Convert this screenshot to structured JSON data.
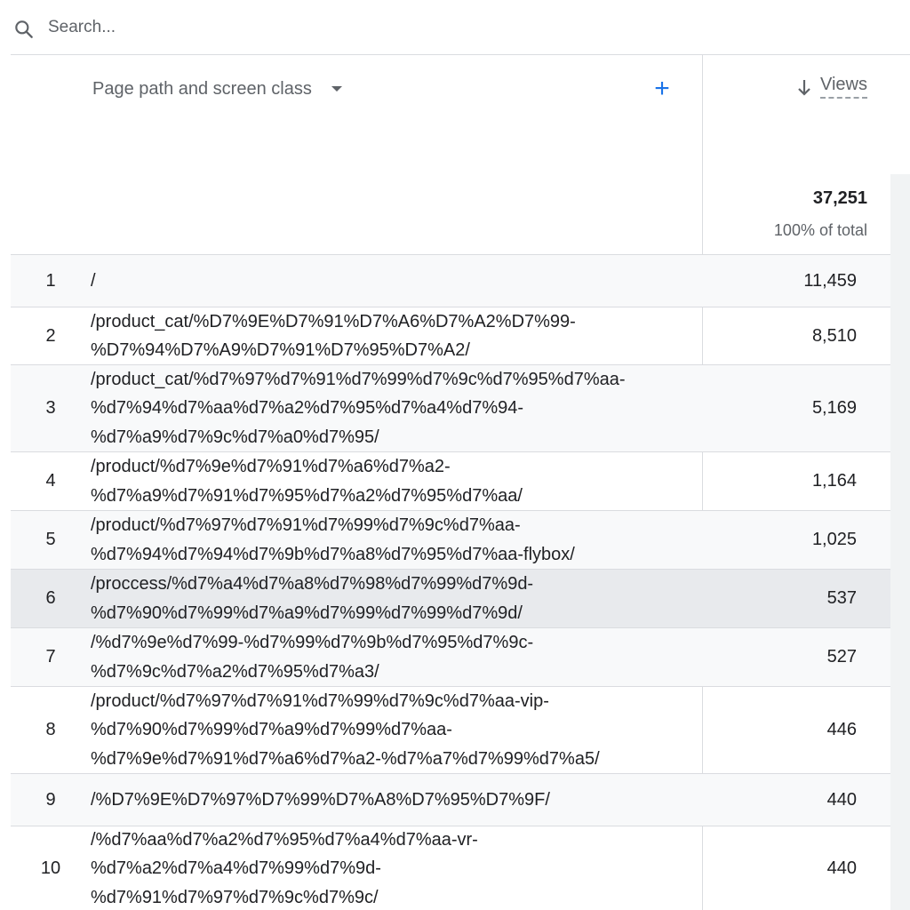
{
  "search": {
    "placeholder": "Search..."
  },
  "table": {
    "dimension_header": "Page path and screen class",
    "metric_header": "Views",
    "total_value": "37,251",
    "total_percent": "100% of total",
    "rows": [
      {
        "index": "1",
        "path": "/",
        "views": "11,459"
      },
      {
        "index": "2",
        "path": "/product_cat/%D7%9E%D7%91%D7%A6%D7%A2%D7%99-\n%D7%94%D7%A9%D7%91%D7%95%D7%A2/",
        "views": "8,510"
      },
      {
        "index": "3",
        "path": "/product_cat/%d7%97%d7%91%d7%99%d7%9c%d7%95%d7%aa-\n%d7%94%d7%aa%d7%a2%d7%95%d7%a4%d7%94-\n%d7%a9%d7%9c%d7%a0%d7%95/",
        "views": "5,169"
      },
      {
        "index": "4",
        "path": "/product/%d7%9e%d7%91%d7%a6%d7%a2-\n%d7%a9%d7%91%d7%95%d7%a2%d7%95%d7%aa/",
        "views": "1,164"
      },
      {
        "index": "5",
        "path": "/product/%d7%97%d7%91%d7%99%d7%9c%d7%aa-\n%d7%94%d7%94%d7%9b%d7%a8%d7%95%d7%aa-flybox/",
        "views": "1,025"
      },
      {
        "index": "6",
        "path": "/proccess/%d7%a4%d7%a8%d7%98%d7%99%d7%9d-\n%d7%90%d7%99%d7%a9%d7%99%d7%99%d7%9d/",
        "views": "537"
      },
      {
        "index": "7",
        "path": "/%d7%9e%d7%99-%d7%99%d7%9b%d7%95%d7%9c-\n%d7%9c%d7%a2%d7%95%d7%a3/",
        "views": "527"
      },
      {
        "index": "8",
        "path": "/product/%d7%97%d7%91%d7%99%d7%9c%d7%aa-vip-\n%d7%90%d7%99%d7%a9%d7%99%d7%aa-\n%d7%9e%d7%91%d7%a6%d7%a2-%d7%a7%d7%99%d7%a5/",
        "views": "446"
      },
      {
        "index": "9",
        "path": "/%D7%9E%D7%97%D7%99%D7%A8%D7%95%D7%9F/",
        "views": "440"
      },
      {
        "index": "10",
        "path": "/%d7%aa%d7%a2%d7%95%d7%a4%d7%aa-vr-\n%d7%a2%d7%a4%d7%99%d7%9d-\n%d7%91%d7%97%d7%9c%d7%9c/",
        "views": "440"
      }
    ]
  }
}
